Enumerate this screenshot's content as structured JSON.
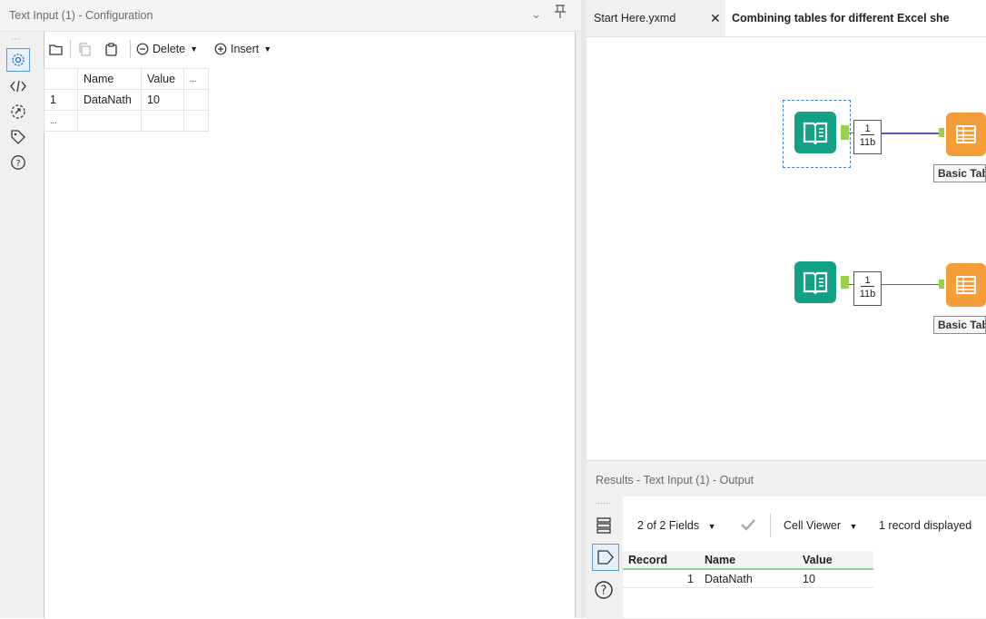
{
  "config_panel": {
    "title": "Text Input (1) - Configuration",
    "collapse_icon": "chevron-down-icon",
    "pin_icon": "pin-icon",
    "rail_icons": [
      "settings-icon",
      "xml-code-icon",
      "annotation-icon",
      "tag-icon",
      "help-icon"
    ],
    "toolbar": {
      "open_icon": "folder-icon",
      "copy_icon": "copy-icon",
      "paste_icon": "paste-icon",
      "delete_label": "Delete",
      "insert_label": "Insert"
    },
    "grid": {
      "columns": [
        "",
        "Name",
        "Value",
        "..."
      ],
      "rows": [
        [
          "1",
          "DataNath",
          "10",
          ""
        ],
        [
          "...",
          "",
          "",
          ""
        ]
      ]
    }
  },
  "tabs": [
    {
      "label": "Start Here.yxmd",
      "close": "✕"
    },
    {
      "label": "Combining tables for different Excel she"
    }
  ],
  "canvas": {
    "tools": [
      {
        "type": "text-input-icon",
        "count_top": "1",
        "count_bottom": "11b",
        "output_label": "Basic Tab",
        "selected": true,
        "connection_color": "#6a4fb3"
      },
      {
        "type": "text-input-icon",
        "count_top": "1",
        "count_bottom": "11b",
        "output_label": "Basic Tab",
        "selected": false,
        "connection_color": "#666666"
      }
    ]
  },
  "results": {
    "title": "Results - Text Input (1) - Output",
    "fields_label": "2 of 2 Fields",
    "cell_viewer_label": "Cell Viewer",
    "records_label": "1 record displayed",
    "table": {
      "headers": [
        "Record",
        "Name",
        "Value"
      ],
      "rows": [
        [
          "1",
          "DataNath",
          "10"
        ]
      ]
    }
  },
  "colors": {
    "accent_blue": "#5b9bd5",
    "tool_green": "#13a185",
    "output_orange": "#f29d38",
    "connector_green": "#9ad145",
    "header_underline_green": "#8bd48e"
  }
}
